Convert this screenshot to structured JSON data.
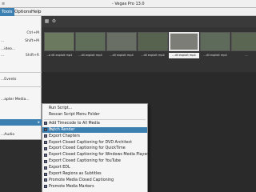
{
  "window": {
    "title": "- Vegas Pro 13.0",
    "sys_glyph": "≡"
  },
  "menubar": {
    "items": [
      {
        "label": "Tools",
        "active": true
      },
      {
        "label": "Options",
        "active": false
      },
      {
        "label": "Help",
        "active": false
      }
    ]
  },
  "media": {
    "thumbnails": [
      {
        "label": "...a dll exploit mp4",
        "selected": false,
        "color": "#6b7a5e"
      },
      {
        "label": "...dll exploit mp4",
        "selected": false,
        "color": "#5f6e58"
      },
      {
        "label": "...dll exploit mp4",
        "selected": false,
        "color": "#6a6f66"
      },
      {
        "label": "...dll exploit mp4",
        "selected": false,
        "color": "#58634f"
      },
      {
        "label": "...dll exploit mp4",
        "selected": true,
        "color": "#7d7d78"
      },
      {
        "label": "...dll exploit mp4",
        "selected": false,
        "color": "#5f6b5a"
      },
      {
        "label": "...",
        "selected": false,
        "color": "#5a6552"
      }
    ]
  },
  "file_menu": {
    "rows": [
      {
        "label": "...",
        "shortcut": "Ctrl+M"
      },
      {
        "label": "...",
        "shortcut": "Shift+M"
      },
      {
        "label": "...ideo...",
        "shortcut": ""
      },
      {
        "label": "...",
        "shortcut": "Shift+R"
      },
      {
        "label": "...",
        "shortcut": ""
      },
      {
        "label": "...Events",
        "shortcut": ""
      },
      {
        "label": "...apter Media...",
        "shortcut": ""
      },
      {
        "label": "",
        "shortcut": "",
        "highlight": true,
        "has_submenu": true
      },
      {
        "label": "...Audio",
        "shortcut": ""
      }
    ]
  },
  "scripting_menu": {
    "rows": [
      {
        "label": "Run Script...",
        "icon": false
      },
      {
        "label": "Rescan Script Menu Folder",
        "icon": false
      },
      {
        "label": "Add Timecode to All Media",
        "icon": true
      },
      {
        "label": "Batch Render",
        "icon": true,
        "highlight": true
      },
      {
        "label": "Export Chapters",
        "icon": true
      },
      {
        "label": "Export Closed Captioning for DVD Architect",
        "icon": true
      },
      {
        "label": "Export Closed Captioning for QuickTime",
        "icon": true
      },
      {
        "label": "Export Closed Captioning for Windows Media Player",
        "icon": true
      },
      {
        "label": "Export Closed Captioning for YouTube",
        "icon": true
      },
      {
        "label": "Export EDL",
        "icon": true
      },
      {
        "label": "Export Regions as Subtitles",
        "icon": true
      },
      {
        "label": "Promote Media Closed Captioning",
        "icon": true
      },
      {
        "label": "Promote Media Markers",
        "icon": true
      }
    ]
  }
}
